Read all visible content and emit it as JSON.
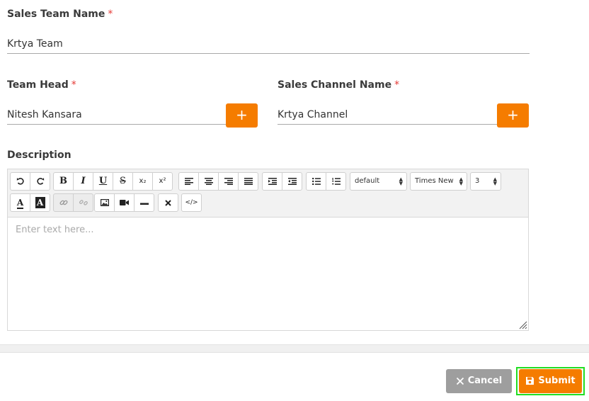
{
  "form": {
    "team_name": {
      "label": "Sales Team Name",
      "required": "*",
      "value": "Krtya Team"
    },
    "team_head": {
      "label": "Team Head",
      "required": "*",
      "value": "Nitesh Kansara",
      "add": "+"
    },
    "channel": {
      "label": "Sales Channel Name",
      "required": "*",
      "value": "Krtya Channel",
      "add": "+"
    },
    "description": {
      "label": "Description",
      "placeholder": "Enter text here..."
    }
  },
  "toolbar": {
    "bold": "B",
    "italic": "I",
    "underline": "U",
    "strike": "S",
    "subscript": "x₂",
    "superscript": "x²",
    "text_color": "A",
    "bg_color": "A",
    "format_select": "default",
    "font_select": "Times New",
    "size_select": "3",
    "html": "</>"
  },
  "actions": {
    "cancel": "Cancel",
    "submit": "Submit"
  },
  "colors": {
    "accent": "#f57c00",
    "cancel": "#9e9e9e",
    "required": "#e53935",
    "focus": "#22dd22"
  }
}
